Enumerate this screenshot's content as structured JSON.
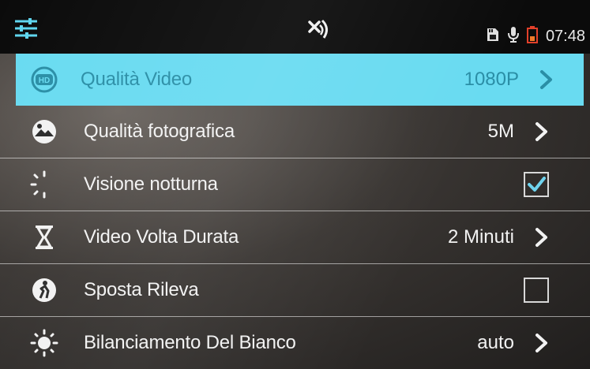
{
  "status_bar": {
    "time": "07:48",
    "icons": [
      "settings-sliders-icon",
      "wifi-disconnected-icon",
      "sd-card-icon",
      "microphone-icon",
      "battery-low-icon"
    ]
  },
  "menu": {
    "items": [
      {
        "label": "Qualità Video",
        "value": "1080P",
        "icon": "hd-icon",
        "control": "chevron",
        "selected": true
      },
      {
        "label": "Qualità fotografica",
        "value": "5M",
        "icon": "photo-quality-icon",
        "control": "chevron",
        "selected": false
      },
      {
        "label": "Visione notturna",
        "value": "",
        "icon": "night-vision-icon",
        "control": "checkbox",
        "checked": true
      },
      {
        "label": "Video Volta Durata",
        "value": "2 Minuti",
        "icon": "hourglass-icon",
        "control": "chevron",
        "selected": false
      },
      {
        "label": "Sposta Rileva",
        "value": "",
        "icon": "motion-detect-icon",
        "control": "checkbox",
        "checked": false
      },
      {
        "label": "Bilanciamento Del Bianco",
        "value": "auto",
        "icon": "white-balance-icon",
        "control": "chevron",
        "selected": false
      }
    ]
  },
  "colors": {
    "selected_bg": "#69dbf1",
    "selected_text": "#2a8ea6",
    "checkbox_check": "#6fd3ee",
    "battery_red": "#e2402a"
  }
}
